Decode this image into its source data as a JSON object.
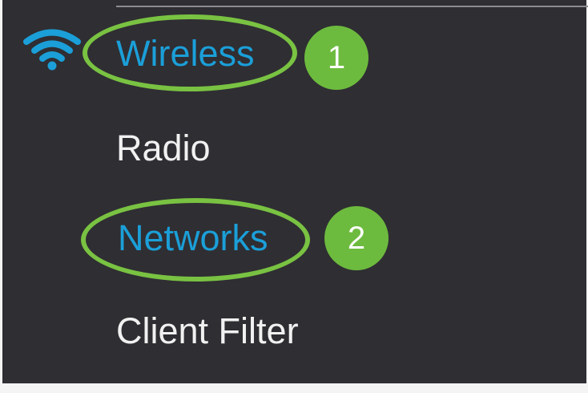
{
  "sidebar": {
    "section_title": "Wireless",
    "section_icon": "wifi-icon",
    "items": [
      {
        "label": "Radio"
      },
      {
        "label": "Networks"
      },
      {
        "label": "Client Filter"
      }
    ]
  },
  "annotations": {
    "steps": [
      {
        "number": "1",
        "target": "Wireless"
      },
      {
        "number": "2",
        "target": "Networks"
      }
    ]
  },
  "colors": {
    "panel_background": "#2f2e33",
    "active_text": "#1b9fd8",
    "inactive_text": "#f1f1f1",
    "annotation_green": "#79c242",
    "annotation_badge": "#6dbb3e"
  }
}
